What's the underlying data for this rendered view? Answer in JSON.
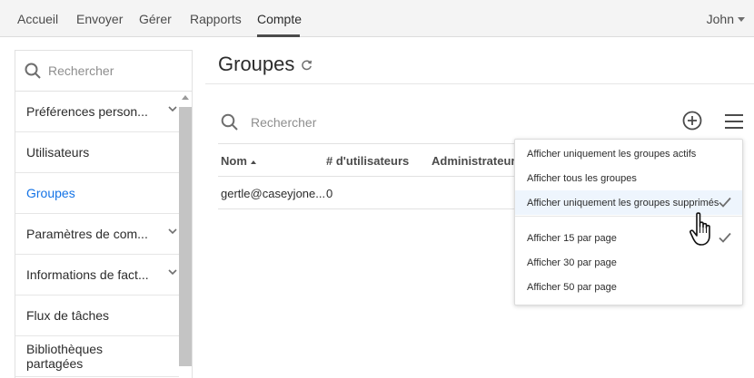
{
  "topnav": {
    "items": [
      {
        "label": "Accueil"
      },
      {
        "label": "Envoyer"
      },
      {
        "label": "Gérer"
      },
      {
        "label": "Rapports"
      },
      {
        "label": "Compte",
        "active": true
      }
    ],
    "user": "John"
  },
  "sidebar": {
    "search_placeholder": "Rechercher",
    "items": [
      {
        "label": "Préférences person...",
        "expandable": true
      },
      {
        "label": "Utilisateurs",
        "expandable": false
      },
      {
        "label": "Groupes",
        "expandable": false,
        "active": true
      },
      {
        "label": "Paramètres de com...",
        "expandable": true
      },
      {
        "label": "Informations de fact...",
        "expandable": true
      },
      {
        "label": "Flux de tâches",
        "expandable": false
      },
      {
        "label": "Bibliothèques partagées",
        "expandable": false
      }
    ]
  },
  "main": {
    "title": "Groupes",
    "search_placeholder": "Rechercher",
    "columns": [
      "Nom",
      "# d'utilisateurs",
      "Administrateur(s"
    ],
    "rows": [
      {
        "name": "gertle@caseyjone...",
        "users": "0"
      }
    ]
  },
  "menu": {
    "filters": [
      {
        "label": "Afficher uniquement les groupes actifs",
        "checked": false
      },
      {
        "label": "Afficher tous les groupes",
        "checked": false
      },
      {
        "label": "Afficher uniquement les groupes supprimés",
        "checked": true,
        "hovered": true
      }
    ],
    "page_sizes": [
      {
        "label": "Afficher 15 par page",
        "checked": true
      },
      {
        "label": "Afficher 30 par page",
        "checked": false
      },
      {
        "label": "Afficher 50 par page",
        "checked": false
      }
    ]
  },
  "colors": {
    "accent": "#1473e6",
    "hover_row": "#eef5fd",
    "text": "#2c2c2c",
    "muted": "#8e8e8e"
  }
}
